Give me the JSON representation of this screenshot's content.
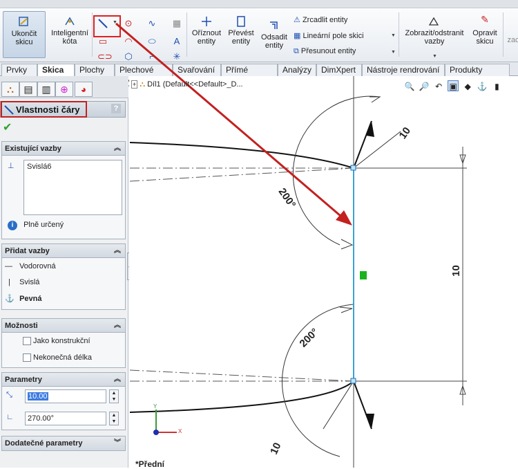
{
  "ribbon": {
    "exit_sketch": "Ukončit\nskicu",
    "smart_dimension": "Inteligentní\nkóta",
    "trim": "Oříznout\nentity",
    "convert": "Převést\nentity",
    "offset": "Odsadit\nentity",
    "mirror": "Zrcadlit entity",
    "linear_pattern": "Lineární pole skici",
    "move": "Přesunout entity",
    "show_relations": "Zobrazit/odstranit\nvazby",
    "repair": "Opravit\nskicu",
    "cut_right": "zac"
  },
  "tabs": [
    "Prvky",
    "Skica",
    "Plochy",
    "Plechové díly",
    "Svařování",
    "Přímé úpravy",
    "Analýzy",
    "DimXpert",
    "Nástroje rendrování",
    "Produkty Office"
  ],
  "active_tab": "Skica",
  "panel": {
    "title": "Vlastnosti čáry",
    "help": "?",
    "existing_relations": {
      "header": "Existující vazby",
      "items": [
        "Svislá6"
      ],
      "status": "Plně určený"
    },
    "add_relations": {
      "header": "Přidat vazby",
      "items": [
        "Vodorovná",
        "Svislá",
        "Pevná"
      ]
    },
    "options": {
      "header": "Možnosti",
      "construction": "Jako konstrukční",
      "infinite": "Nekonečná délka"
    },
    "parameters": {
      "header": "Parametry",
      "length": "10.00",
      "angle": "270.00°"
    },
    "additional": {
      "header": "Dodatečné parametry"
    }
  },
  "tree": {
    "label": "Díl1  (Default<<Default>_D..."
  },
  "canvas": {
    "dim_top": "10",
    "dim_bottom": "10",
    "dim_right": "10",
    "angle_top": "200°",
    "angle_bottom": "200°",
    "view_name": "*Přední"
  },
  "colors": {
    "accent_red": "#c32020",
    "line_blue": "#3aa0d8",
    "relation_green": "#19b31e"
  }
}
